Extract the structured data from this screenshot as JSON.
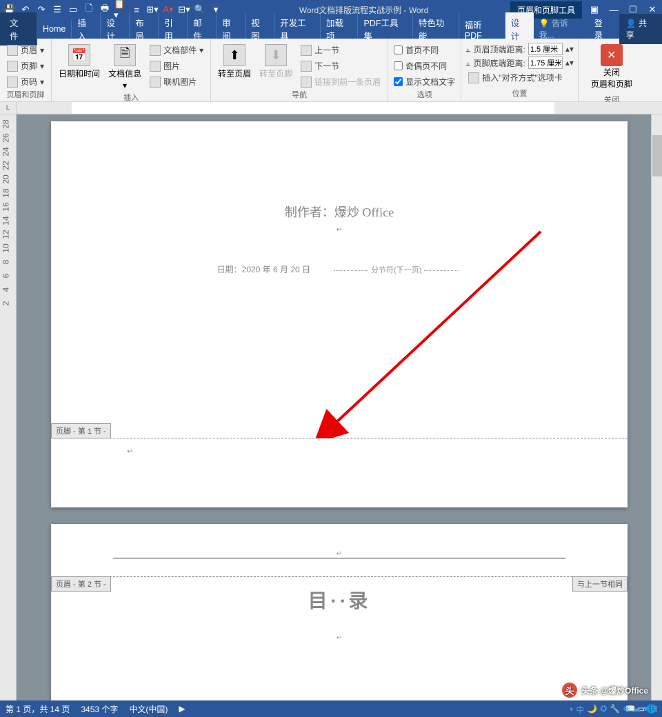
{
  "title": "Word文档排版流程实战示例 - Word",
  "context_tab": "页眉和页脚工具",
  "window": {
    "login": "登录",
    "share": "共享",
    "tell_me": "告诉我..."
  },
  "menu": {
    "file": "文件",
    "home": "Home",
    "insert": "插入",
    "design": "设计",
    "layout": "布局",
    "references": "引用",
    "mailings": "邮件",
    "review": "审阅",
    "view": "视图",
    "developer": "开发工具",
    "addins": "加载项",
    "pdf_tools": "PDF工具集",
    "special": "特色功能",
    "foxit": "福昕PDF",
    "hf_design": "设计"
  },
  "ribbon": {
    "hf": {
      "header": "页眉",
      "footer": "页脚",
      "page_number": "页码",
      "group": "页眉和页脚"
    },
    "insert": {
      "datetime": "日期和时间",
      "docinfo": "文档信息",
      "quickparts": "文档部件",
      "pictures": "图片",
      "online_pic": "联机图片",
      "group": "插入"
    },
    "nav": {
      "goto_header": "转至页眉",
      "goto_footer": "转至页脚",
      "prev": "上一节",
      "next": "下一节",
      "link_prev": "链接到前一条页眉",
      "group": "导航"
    },
    "options": {
      "diff_first": "首页不同",
      "diff_odd_even": "奇偶页不同",
      "show_text": "显示文档文字",
      "group": "选项"
    },
    "position": {
      "header_top": "页眉顶端距离:",
      "footer_bottom": "页脚底端距离:",
      "align_tab": "插入\"对齐方式\"选项卡",
      "val1": "1.5 厘米",
      "val2": "1.75 厘米",
      "group": "位置"
    },
    "close": {
      "label": "关闭\n页眉和页脚",
      "group": "关闭"
    }
  },
  "document": {
    "author_line": "制作者：爆炒 Office",
    "date_line": "日期：2020 年 6 月 20 日",
    "section_break": "分节符(下一页)",
    "footer_tag1": "页脚 - 第 1 节 -",
    "header_tag2": "页眉 - 第 2 节 -",
    "same_as_prev": "与上一节相同",
    "toc": "目··录"
  },
  "status": {
    "page": "第 1 页，共 14 页",
    "words": "3453 个字",
    "lang": "中文(中国)"
  },
  "watermark": "头条 @爆炒Office",
  "ruler_corner": "L"
}
